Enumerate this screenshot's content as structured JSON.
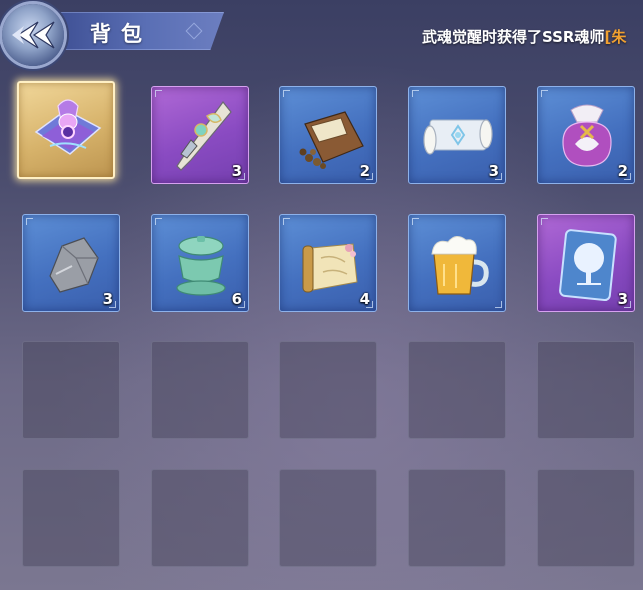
{
  "header": {
    "title": "背包",
    "ticker_text": "武魂觉醒时获得了SSR魂师",
    "ticker_highlight": "[朱"
  },
  "items": [
    {
      "name": "purple-spell-bundle",
      "rarity": "gold",
      "quantity": ""
    },
    {
      "name": "jade-ornament",
      "rarity": "purple",
      "quantity": "3"
    },
    {
      "name": "seed-pouch",
      "rarity": "blue",
      "quantity": "2"
    },
    {
      "name": "scroll",
      "rarity": "blue",
      "quantity": "3"
    },
    {
      "name": "treasure-pouch",
      "rarity": "blue",
      "quantity": "2"
    },
    {
      "name": "ore-stone",
      "rarity": "blue",
      "quantity": "3"
    },
    {
      "name": "jade-teacup",
      "rarity": "blue",
      "quantity": "6"
    },
    {
      "name": "map-scroll",
      "rarity": "blue",
      "quantity": "4"
    },
    {
      "name": "beer-mug",
      "rarity": "blue",
      "quantity": ""
    },
    {
      "name": "tree-card",
      "rarity": "purple",
      "quantity": "3"
    }
  ],
  "empty_slots": 10,
  "colors": {
    "rarity_blue": "#4a78c6",
    "rarity_purple": "#8a4bc2",
    "rarity_gold": "#d7b36b",
    "ticker_highlight": "#f0a030"
  }
}
